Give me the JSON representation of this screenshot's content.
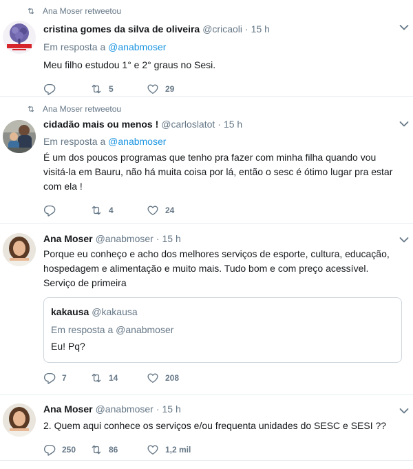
{
  "tweets": [
    {
      "retweet_context": "Ana Moser retweetou",
      "fullname": "cristina gomes da silva de oliveira",
      "username": "@cricaoli",
      "time": "15 h",
      "reply_prefix": "Em resposta a",
      "reply_mention": "@anabmoser",
      "text": "Meu filho estudou 1° e 2° graus no Sesi.",
      "replies": "",
      "retweets": "5",
      "likes": "29"
    },
    {
      "retweet_context": "Ana Moser retweetou",
      "fullname": "cidadão mais ou menos !",
      "username": "@carloslatot",
      "time": "15 h",
      "reply_prefix": "Em resposta a",
      "reply_mention": "@anabmoser",
      "text": "É um dos poucos programas que tenho pra fazer com minha filha quando vou visitá-la em Bauru, não há muita coisa por lá, então o sesc é ótimo lugar pra estar com ela !",
      "replies": "",
      "retweets": "4",
      "likes": "24"
    },
    {
      "fullname": "Ana Moser",
      "username": "@anabmoser",
      "time": "15 h",
      "text": "Porque eu conheço e acho dos melhores serviços de esporte, cultura, educação, hospedagem e alimentação e muito mais. Tudo bom e com preço acessível. Serviço de primeira",
      "quote": {
        "fullname": "kakausa",
        "username": "@kakausa",
        "reply_prefix": "Em resposta a",
        "reply_mention": "@anabmoser",
        "text": "Eu! Pq?"
      },
      "replies": "7",
      "retweets": "14",
      "likes": "208"
    },
    {
      "fullname": "Ana Moser",
      "username": "@anabmoser",
      "time": "15 h",
      "text": "2. Quem aqui conhece os serviços e/ou frequenta unidades do SESC e SESI ??",
      "replies": "250",
      "retweets": "86",
      "likes": "1,2 mil"
    }
  ],
  "colors": {
    "text": "#14171a",
    "secondary": "#657786",
    "link": "#1b95e0",
    "divider": "#e6ecf0"
  },
  "icons": [
    "retweet-icon",
    "reply-icon",
    "like-icon",
    "caret-down-icon",
    "avatar"
  ]
}
